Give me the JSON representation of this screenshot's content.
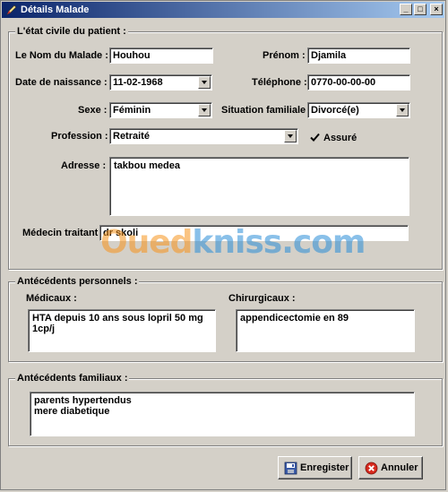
{
  "window": {
    "title": "Détails Malade",
    "min": "_",
    "max": "□",
    "close": "×"
  },
  "civil": {
    "legend": "L'état civile du patient :",
    "nom_label": "Le Nom du Malade :",
    "nom_value": "Houhou",
    "prenom_label": "Prénom :",
    "prenom_value": "Djamila",
    "naissance_label": "Date de naissance :",
    "naissance_value": "11-02-1968",
    "telephone_label": "Téléphone :",
    "telephone_value": "0770-00-00-00",
    "sexe_label": "Sexe :",
    "sexe_value": "Féminin",
    "situation_label": "Situation familiale :",
    "situation_value": "Divorcé(e)",
    "profession_label": "Profession :",
    "profession_value": "Retraité",
    "assure_label": "Assuré",
    "assure_checked": true,
    "adresse_label": "Adresse :",
    "adresse_value": "takbou medea",
    "medecin_label": "Médecin traitant :",
    "medecin_value": "dr skoli"
  },
  "perso": {
    "legend": "Antécédents personnels :",
    "medicaux_label": "Médicaux :",
    "medicaux_value": "HTA depuis 10 ans sous lopril 50 mg\n1cp/j",
    "chirurgicaux_label": "Chirurgicaux :",
    "chirurgicaux_value": "appendicectomie en 89"
  },
  "familiaux": {
    "legend": "Antécédents familiaux :",
    "value": "parents hypertendus\nmere diabetique"
  },
  "buttons": {
    "save": "Enregister",
    "cancel": "Annuler"
  },
  "watermark": {
    "part1": "Oued",
    "part2": "kniss",
    "part3": ".com"
  },
  "colors": {
    "titlebar_start": "#0a246a",
    "titlebar_end": "#a6caf0",
    "wm_orange": "#f7941d",
    "wm_blue": "#2a8ed8"
  }
}
